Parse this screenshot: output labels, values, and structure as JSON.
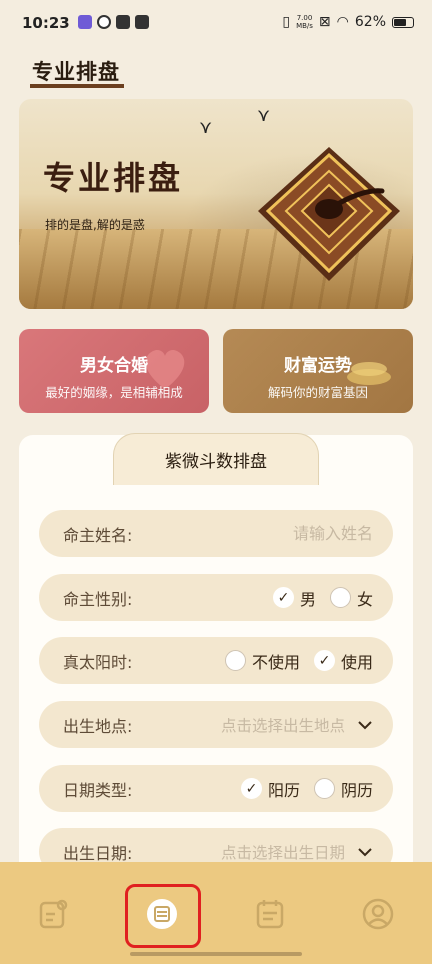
{
  "status_bar": {
    "time": "10:23",
    "net_speed_value": "7.00",
    "net_speed_unit": "MB/s",
    "battery": "62%"
  },
  "header": {
    "title": "专业排盘"
  },
  "banner": {
    "title": "专业排盘",
    "subtitle": "排的是盘,解的是惑"
  },
  "feature_cards": [
    {
      "title": "男女合婚",
      "subtitle": "最好的姻缘，是相辅相成",
      "color": "#d06b6e"
    },
    {
      "title": "财富运势",
      "subtitle": "解码你的财富基因",
      "color": "#ab7f4b"
    }
  ],
  "form": {
    "tab_title": "紫微斗数排盘",
    "name": {
      "label": "命主姓名:",
      "placeholder": "请输入姓名",
      "value": ""
    },
    "gender": {
      "label": "命主性别:",
      "options": [
        "男",
        "女"
      ],
      "selected": "男"
    },
    "solar_time": {
      "label": "真太阳时:",
      "options": [
        "不使用",
        "使用"
      ],
      "selected": "使用"
    },
    "birthplace": {
      "label": "出生地点:",
      "placeholder": "点击选择出生地点"
    },
    "date_type": {
      "label": "日期类型:",
      "options": [
        "阳历",
        "阴历"
      ],
      "selected": "阳历"
    },
    "birth_date": {
      "label": "出生日期:",
      "placeholder": "点击选择出生日期"
    }
  },
  "bottom_nav": {
    "items": [
      {
        "icon": "edit-note-icon",
        "active": false
      },
      {
        "icon": "chart-disc-icon",
        "active": true
      },
      {
        "icon": "calendar-list-icon",
        "active": false
      },
      {
        "icon": "profile-icon",
        "active": false
      }
    ],
    "highlight_color": "#e02020"
  },
  "colors": {
    "background": "#f4eddf",
    "field_bg": "#f3e7cf",
    "nav_bg": "#ecc981",
    "title_underline": "#6b3f1f"
  }
}
